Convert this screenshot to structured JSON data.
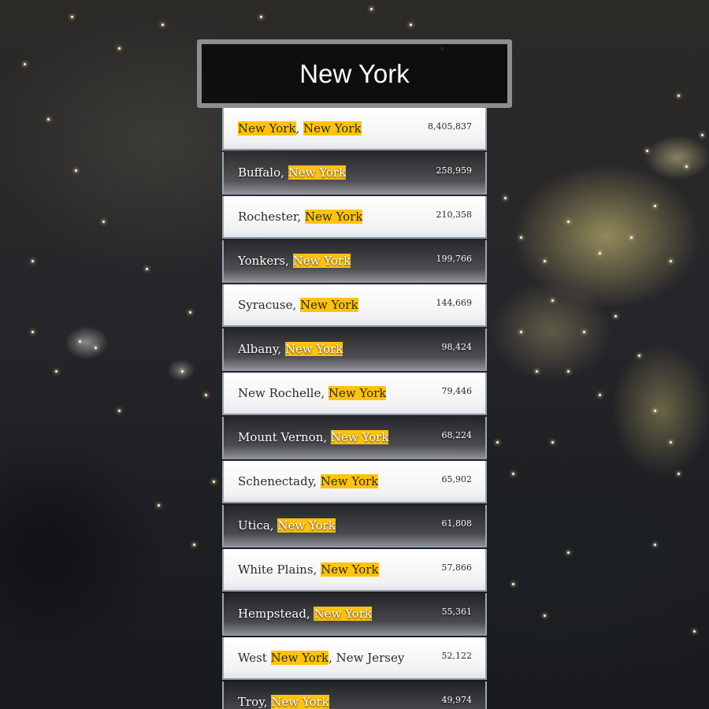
{
  "search": {
    "value": "New York",
    "highlight_color": "#ffc20e"
  },
  "results": [
    {
      "prefix": "",
      "match": "New York",
      "suffix": ", ",
      "match2": "New York",
      "suffix2": "",
      "population": "8,405,837"
    },
    {
      "prefix": "Buffalo, ",
      "match": "New York",
      "suffix": "",
      "match2": "",
      "suffix2": "",
      "population": "258,959"
    },
    {
      "prefix": "Rochester, ",
      "match": "New York",
      "suffix": "",
      "match2": "",
      "suffix2": "",
      "population": "210,358"
    },
    {
      "prefix": "Yonkers, ",
      "match": "New York",
      "suffix": "",
      "match2": "",
      "suffix2": "",
      "population": "199,766"
    },
    {
      "prefix": "Syracuse, ",
      "match": "New York",
      "suffix": "",
      "match2": "",
      "suffix2": "",
      "population": "144,669"
    },
    {
      "prefix": "Albany, ",
      "match": "New York",
      "suffix": "",
      "match2": "",
      "suffix2": "",
      "population": "98,424"
    },
    {
      "prefix": "New Rochelle, ",
      "match": "New York",
      "suffix": "",
      "match2": "",
      "suffix2": "",
      "population": "79,446"
    },
    {
      "prefix": "Mount Vernon, ",
      "match": "New York",
      "suffix": "",
      "match2": "",
      "suffix2": "",
      "population": "68,224"
    },
    {
      "prefix": "Schenectady, ",
      "match": "New York",
      "suffix": "",
      "match2": "",
      "suffix2": "",
      "population": "65,902"
    },
    {
      "prefix": "Utica, ",
      "match": "New York",
      "suffix": "",
      "match2": "",
      "suffix2": "",
      "population": "61,808"
    },
    {
      "prefix": "White Plains, ",
      "match": "New York",
      "suffix": "",
      "match2": "",
      "suffix2": "",
      "population": "57,866"
    },
    {
      "prefix": "Hempstead, ",
      "match": "New York",
      "suffix": "",
      "match2": "",
      "suffix2": "",
      "population": "55,361"
    },
    {
      "prefix": "West ",
      "match": "New York",
      "suffix": ", New Jersey",
      "match2": "",
      "suffix2": "",
      "population": "52,122"
    },
    {
      "prefix": "Troy, ",
      "match": "New York",
      "suffix": "",
      "match2": "",
      "suffix2": "",
      "population": "49,974"
    }
  ]
}
